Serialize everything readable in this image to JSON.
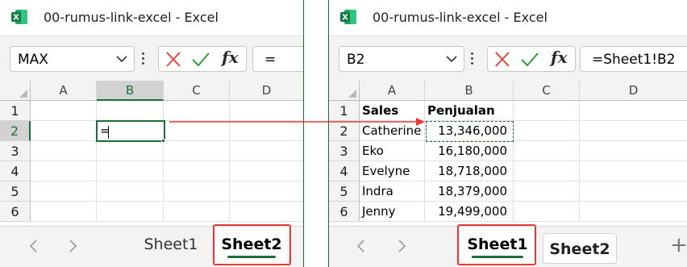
{
  "colors": {
    "excel_green": "#1e6e3a",
    "highlight_red": "#e53935",
    "cancel_red": "#e2463b",
    "confirm_green": "#2e9e3a"
  },
  "icons": {
    "app": "excel-logo-icon",
    "namebox": "chevron-down-icon",
    "menu": "vertical-dots-icon",
    "cancel": "x-mark-icon",
    "enter": "checkmark-icon",
    "function": "fx-icon",
    "prev": "chevron-left-icon",
    "next": "chevron-right-icon",
    "add_sheet": "plus-icon"
  },
  "left_window": {
    "app_logo_letter": "X",
    "title": "00-rumus-link-excel - Excel",
    "name_box": "MAX",
    "fx_label": "fx",
    "formula": "=",
    "column_headers": [
      "A",
      "B",
      "C",
      "D"
    ],
    "row_headers": [
      "1",
      "2",
      "3",
      "4",
      "5",
      "6"
    ],
    "active_cell": "B2",
    "editing_text": "=",
    "sheet_tabs": [
      "Sheet1",
      "Sheet2"
    ],
    "active_sheet": "Sheet2"
  },
  "right_window": {
    "app_logo_letter": "X",
    "title": "00-rumus-link-excel - Excel",
    "name_box": "B2",
    "fx_label": "fx",
    "formula": "=Sheet1!B2",
    "column_headers": [
      "A",
      "B",
      "C",
      "D"
    ],
    "row_headers": [
      "1",
      "2",
      "3",
      "4",
      "5",
      "6"
    ],
    "header_row": [
      "Sales",
      "Penjualan"
    ],
    "rows": [
      [
        "Catherine",
        "13,346,000"
      ],
      [
        "Eko",
        "16,180,000"
      ],
      [
        "Evelyne",
        "18,718,000"
      ],
      [
        "Indra",
        "18,379,000"
      ],
      [
        "Jenny",
        "19,499,000"
      ]
    ],
    "selected_cell": "B2",
    "sheet_tabs": [
      "Sheet1",
      "Sheet2"
    ],
    "active_sheet": "Sheet1",
    "add_sheet_symbol": "+"
  }
}
